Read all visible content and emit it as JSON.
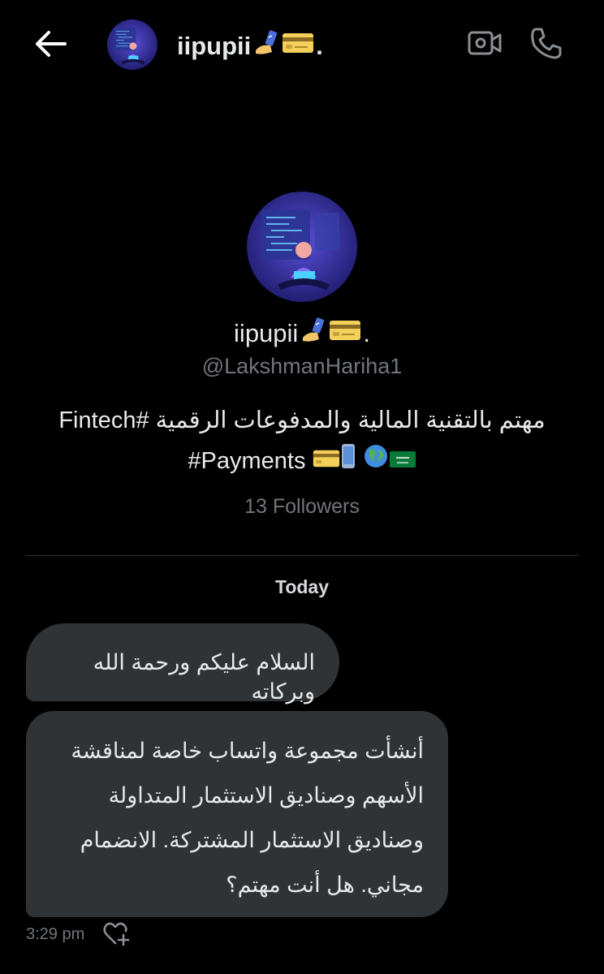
{
  "header": {
    "name": "iipupii",
    "name_suffix": ".",
    "back_icon": "arrow-left-icon",
    "video_icon": "video-camera-icon",
    "phone_icon": "phone-icon"
  },
  "profile": {
    "name": "iipupii",
    "name_suffix": ".",
    "handle": "@LakshmanHariha1",
    "bio_line1": "مهتم بالتقنية المالية والمدفوعات الرقمية #Fintech",
    "bio_line2_text": "#Payments",
    "followers": "13 Followers"
  },
  "conversation": {
    "day_label": "Today",
    "messages": [
      {
        "text": "السلام عليكم ورحمة الله وبركاته"
      },
      {
        "text": "أنشأت مجموعة واتساب خاصة لمناقشة الأسهم وصناديق الاستثمار المتداولة وصناديق الاستثمار المشتركة. الانضمام مجاني. هل أنت مهتم؟"
      }
    ],
    "timestamp": "3:29 pm"
  },
  "colors": {
    "background": "#000000",
    "bubble": "#2f3336",
    "text": "#e7e9ea",
    "secondary": "#71767b",
    "divider": "#2f3336"
  }
}
